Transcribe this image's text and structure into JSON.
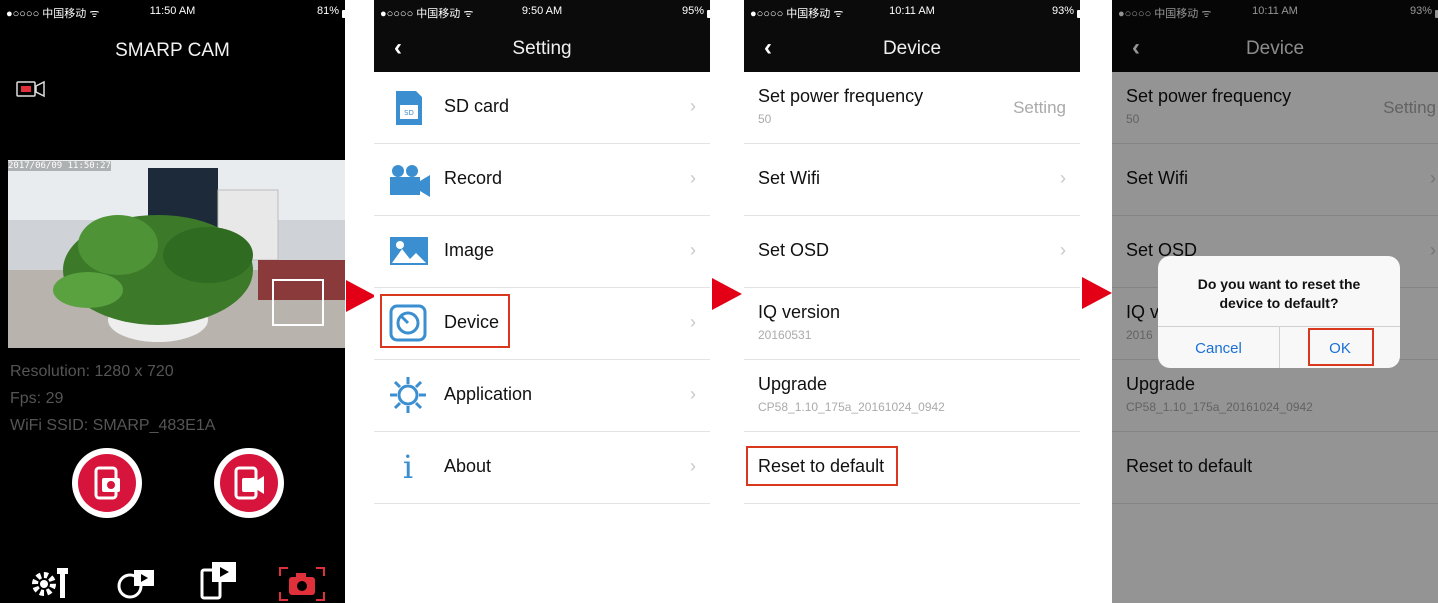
{
  "phone1": {
    "status": {
      "carrier": "●○○○○ 中国移动 ᯤ",
      "time": "11:50 AM",
      "battery": "81%"
    },
    "app_title": "SMARP CAM",
    "video_timestamp": "2017/06/09 11:50:27",
    "info": {
      "resolution": "Resolution: 1280 x 720",
      "fps": "Fps: 29",
      "ssid": "WiFi SSID: SMARP_483E1A"
    }
  },
  "phone2": {
    "status": {
      "carrier": "●○○○○ 中国移动 ᯤ",
      "time": "9:50 AM",
      "battery": "95%"
    },
    "title": "Setting",
    "back": "‹",
    "items": [
      {
        "label": "SD card",
        "icon": "sd-card-icon"
      },
      {
        "label": "Record",
        "icon": "video-camera-icon"
      },
      {
        "label": "Image",
        "icon": "image-icon"
      },
      {
        "label": "Device",
        "icon": "device-icon"
      },
      {
        "label": "Application",
        "icon": "application-gear-icon"
      },
      {
        "label": "About",
        "icon": "info-icon"
      }
    ],
    "chevron": "›",
    "about_glyph": "i"
  },
  "phone3": {
    "status": {
      "carrier": "●○○○○ 中国移动 ᯤ",
      "time": "10:11 AM",
      "battery": "93%"
    },
    "title": "Device",
    "back": "‹",
    "rows": [
      {
        "label": "Set power frequency",
        "sub": "50",
        "value": "Setting"
      },
      {
        "label": "Set Wifi",
        "sub": "",
        "value": ""
      },
      {
        "label": "Set OSD",
        "sub": "",
        "value": ""
      },
      {
        "label": "IQ version",
        "sub": "20160531",
        "value": ""
      },
      {
        "label": "Upgrade",
        "sub": "CP58_1.10_175a_20161024_0942",
        "value": ""
      },
      {
        "label": "Reset to default",
        "sub": "",
        "value": ""
      }
    ],
    "chevron": "›"
  },
  "phone4": {
    "status": {
      "carrier": "●○○○○ 中国移动 ᯤ",
      "time": "10:11 AM",
      "battery": "93%"
    },
    "title": "Device",
    "back": "‹",
    "rows": [
      {
        "label": "Set power frequency",
        "sub": "50",
        "value": "Setting"
      },
      {
        "label": "Set Wifi",
        "sub": "",
        "value": ""
      },
      {
        "label": "Set OSD",
        "sub": "",
        "value": ""
      },
      {
        "label": "IQ v",
        "sub": "2016",
        "value": ""
      },
      {
        "label": "Upgrade",
        "sub": "CP58_1.10_175a_20161024_0942",
        "value": ""
      },
      {
        "label": "Reset to default",
        "sub": "",
        "value": ""
      }
    ],
    "chevron": "›",
    "dialog": {
      "message_line1": "Do you want to reset the",
      "message_line2": "device to default?",
      "cancel": "Cancel",
      "ok": "OK"
    }
  },
  "colors": {
    "accent_red": "#d9381e",
    "arrow_red": "#e30016",
    "button_red": "#d7143b",
    "ios_blue": "#1a6fd6",
    "icon_blue": "#2f84c8"
  }
}
